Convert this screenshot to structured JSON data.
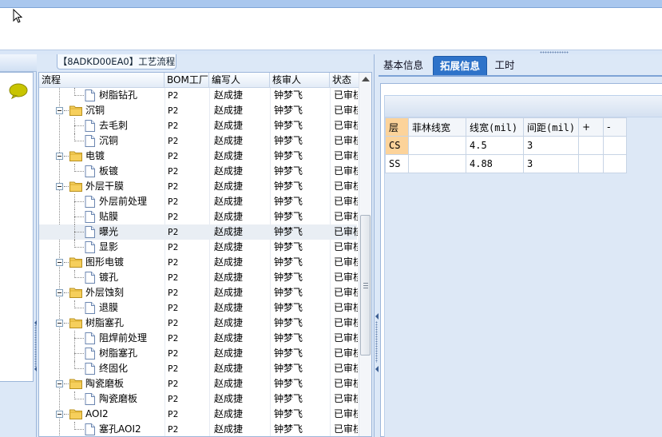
{
  "left_grid": {
    "panel_title": "【8ADKD00EA0】工艺流程",
    "columns": [
      "流程",
      "BOM工厂",
      "编写人",
      "核审人",
      "状态"
    ],
    "rows": [
      {
        "name": "树脂钻孔",
        "level": 1,
        "type": "doc",
        "bom": "P2",
        "author": "赵成捷",
        "reviewer": "钟梦飞",
        "status": "已审核"
      },
      {
        "name": "沉铜",
        "level": 0,
        "type": "folder",
        "bom": "P2",
        "author": "赵成捷",
        "reviewer": "钟梦飞",
        "status": "已审核"
      },
      {
        "name": "去毛刺",
        "level": 1,
        "type": "doc",
        "bom": "P2",
        "author": "赵成捷",
        "reviewer": "钟梦飞",
        "status": "已审核"
      },
      {
        "name": "沉铜",
        "level": 1,
        "type": "doc",
        "bom": "P2",
        "author": "赵成捷",
        "reviewer": "钟梦飞",
        "status": "已审核"
      },
      {
        "name": "电镀",
        "level": 0,
        "type": "folder",
        "bom": "P2",
        "author": "赵成捷",
        "reviewer": "钟梦飞",
        "status": "已审核"
      },
      {
        "name": "板镀",
        "level": 1,
        "type": "doc",
        "bom": "P2",
        "author": "赵成捷",
        "reviewer": "钟梦飞",
        "status": "已审核"
      },
      {
        "name": "外层干膜",
        "level": 0,
        "type": "folder",
        "bom": "P2",
        "author": "赵成捷",
        "reviewer": "钟梦飞",
        "status": "已审核"
      },
      {
        "name": "外层前处理",
        "level": 1,
        "type": "doc",
        "bom": "P2",
        "author": "赵成捷",
        "reviewer": "钟梦飞",
        "status": "已审核"
      },
      {
        "name": "贴膜",
        "level": 1,
        "type": "doc",
        "bom": "P2",
        "author": "赵成捷",
        "reviewer": "钟梦飞",
        "status": "已审核"
      },
      {
        "name": "曝光",
        "level": 1,
        "type": "doc",
        "bom": "P2",
        "author": "赵成捷",
        "reviewer": "钟梦飞",
        "status": "已审核",
        "selected": true
      },
      {
        "name": "显影",
        "level": 1,
        "type": "doc",
        "bom": "P2",
        "author": "赵成捷",
        "reviewer": "钟梦飞",
        "status": "已审核"
      },
      {
        "name": "图形电镀",
        "level": 0,
        "type": "folder",
        "bom": "P2",
        "author": "赵成捷",
        "reviewer": "钟梦飞",
        "status": "已审核"
      },
      {
        "name": "镀孔",
        "level": 1,
        "type": "doc",
        "bom": "P2",
        "author": "赵成捷",
        "reviewer": "钟梦飞",
        "status": "已审核"
      },
      {
        "name": "外层蚀刻",
        "level": 0,
        "type": "folder",
        "bom": "P2",
        "author": "赵成捷",
        "reviewer": "钟梦飞",
        "status": "已审核"
      },
      {
        "name": "退膜",
        "level": 1,
        "type": "doc",
        "bom": "P2",
        "author": "赵成捷",
        "reviewer": "钟梦飞",
        "status": "已审核"
      },
      {
        "name": "树脂塞孔",
        "level": 0,
        "type": "folder",
        "bom": "P2",
        "author": "赵成捷",
        "reviewer": "钟梦飞",
        "status": "已审核"
      },
      {
        "name": "阻焊前处理",
        "level": 1,
        "type": "doc",
        "bom": "P2",
        "author": "赵成捷",
        "reviewer": "钟梦飞",
        "status": "已审核"
      },
      {
        "name": "树脂塞孔",
        "level": 1,
        "type": "doc",
        "bom": "P2",
        "author": "赵成捷",
        "reviewer": "钟梦飞",
        "status": "已审核"
      },
      {
        "name": "终固化",
        "level": 1,
        "type": "doc",
        "bom": "P2",
        "author": "赵成捷",
        "reviewer": "钟梦飞",
        "status": "已审核"
      },
      {
        "name": "陶瓷磨板",
        "level": 0,
        "type": "folder",
        "bom": "P2",
        "author": "赵成捷",
        "reviewer": "钟梦飞",
        "status": "已审核"
      },
      {
        "name": "陶瓷磨板",
        "level": 1,
        "type": "doc",
        "bom": "P2",
        "author": "赵成捷",
        "reviewer": "钟梦飞",
        "status": "已审核"
      },
      {
        "name": "AOI2",
        "level": 0,
        "type": "folder",
        "bom": "P2",
        "author": "赵成捷",
        "reviewer": "钟梦飞",
        "status": "已审核"
      },
      {
        "name": "塞孔AOI2",
        "level": 1,
        "type": "doc",
        "bom": "P2",
        "author": "赵成捷",
        "reviewer": "钟梦飞",
        "status": "已审核"
      }
    ]
  },
  "right_panel": {
    "tabs": [
      {
        "label": "基本信息",
        "active": false
      },
      {
        "label": "拓展信息",
        "active": true
      },
      {
        "label": "工时",
        "active": false
      }
    ],
    "table": {
      "headers": [
        "层",
        "菲林线宽",
        "线宽(mil)",
        "间距(mil)",
        "+",
        "-"
      ],
      "rows": [
        {
          "layer": "CS",
          "film_width": "",
          "line_width": "4.5",
          "spacing": "3"
        },
        {
          "layer": "SS",
          "film_width": "",
          "line_width": "4.88",
          "spacing": "3"
        }
      ]
    }
  },
  "colors": {
    "accent_tab": "#2e73c9",
    "panel_bg": "#dce8f7",
    "highlight_cell": "#fcd39a"
  }
}
